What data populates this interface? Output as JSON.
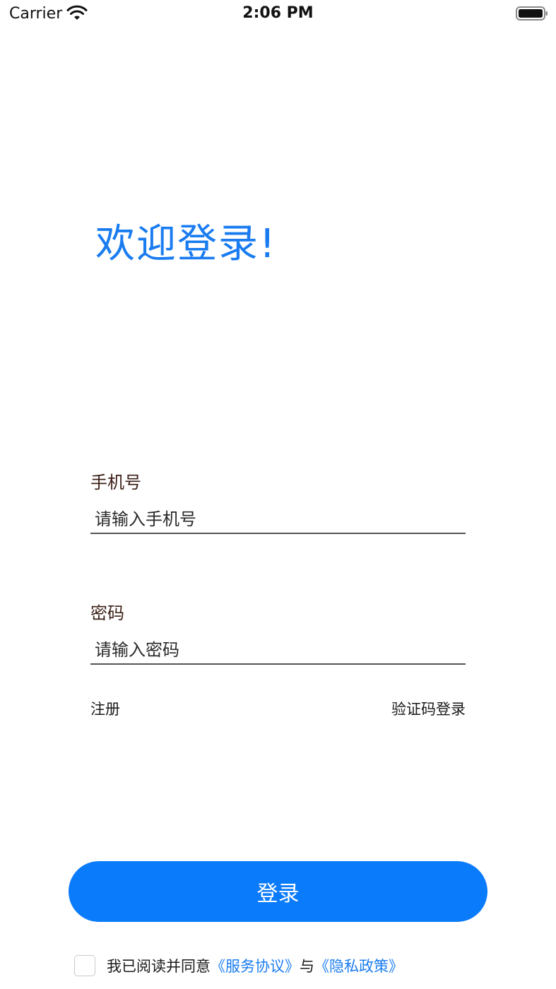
{
  "status_bar": {
    "carrier": "Carrier",
    "time": "2:06 PM",
    "wifi_icon": "wifi-icon",
    "battery_icon": "battery-icon"
  },
  "welcome_title": "欢迎登录!",
  "phone": {
    "label": "手机号",
    "placeholder": "请输入手机号",
    "value": ""
  },
  "password": {
    "label": "密码",
    "placeholder": "请输入密码",
    "value": ""
  },
  "links": {
    "register": "注册",
    "sms_login": "验证码登录"
  },
  "login_button_label": "登录",
  "agreement": {
    "checked": false,
    "prefix": "我已阅读并同意",
    "service_link": "《服务协议》",
    "conjunction": "与",
    "privacy_link": "《隐私政策》"
  },
  "colors": {
    "accent": "#0a7bfb",
    "title": "#1a7cf0",
    "label": "#3b1f17"
  }
}
